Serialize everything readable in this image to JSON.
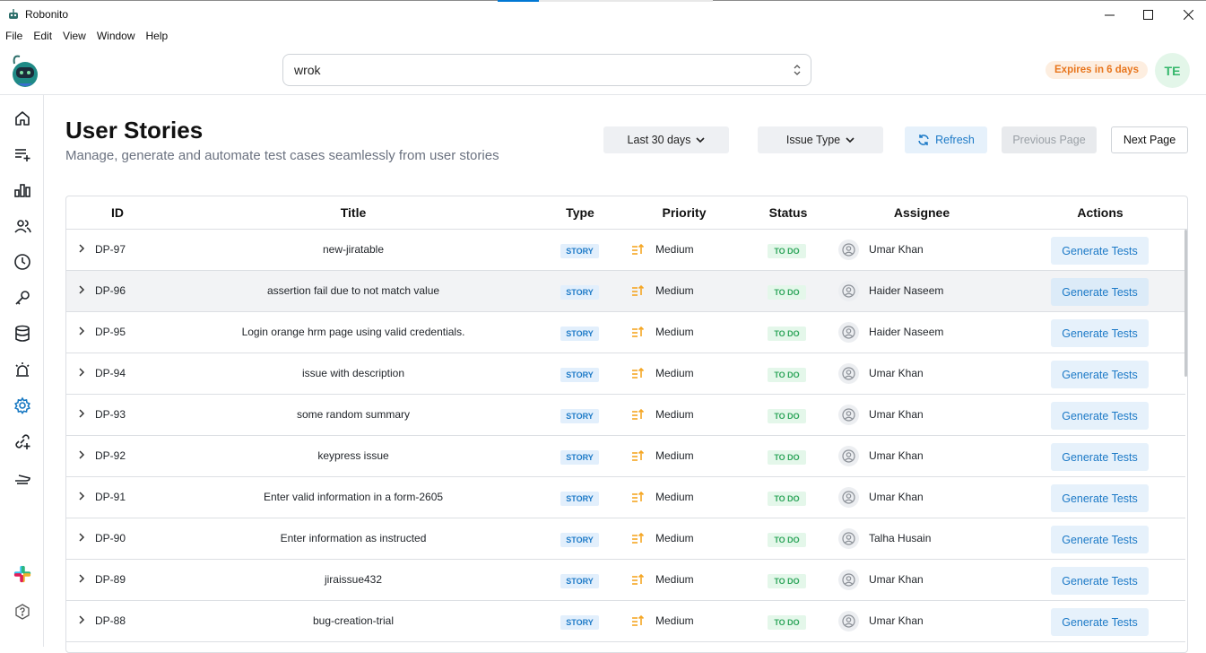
{
  "window": {
    "title": "Robonito",
    "controls": [
      "minimize",
      "maximize",
      "close"
    ]
  },
  "menu": [
    "File",
    "Edit",
    "View",
    "Window",
    "Help"
  ],
  "header": {
    "search_value": "wrok",
    "expires_badge": "Expires in 6 days",
    "avatar_initials": "TE"
  },
  "sidebar": {
    "items": [
      "home-icon",
      "add-list-icon",
      "bar-chart-icon",
      "users-icon",
      "clock-icon",
      "key-icon",
      "database-icon",
      "alarm-icon",
      "settings-icon",
      "link-add-icon",
      "drone-icon",
      "slack-icon",
      "help-icon"
    ],
    "active": "settings-icon"
  },
  "page": {
    "title": "User Stories",
    "subtitle": "Manage, generate and automate test cases seamlessly from user stories"
  },
  "toolbar": {
    "date_filter": "Last 30 days",
    "type_filter": "Issue Type",
    "refresh": "Refresh",
    "previous": "Previous Page",
    "next": "Next Page"
  },
  "table": {
    "columns": [
      "ID",
      "Title",
      "Type",
      "Priority",
      "Status",
      "Assignee",
      "Actions"
    ],
    "rows": [
      {
        "id": "DP-97",
        "title": "new-jiratable",
        "type": "STORY",
        "priority": "Medium",
        "status": "TO DO",
        "assignee": "Umar Khan",
        "action": "Generate Tests"
      },
      {
        "id": "DP-96",
        "title": "assertion fail due to not match value",
        "type": "STORY",
        "priority": "Medium",
        "status": "TO DO",
        "assignee": "Haider Naseem",
        "action": "Generate Tests"
      },
      {
        "id": "DP-95",
        "title": "Login orange hrm page using valid credentials.",
        "type": "STORY",
        "priority": "Medium",
        "status": "TO DO",
        "assignee": "Haider Naseem",
        "action": "Generate Tests"
      },
      {
        "id": "DP-94",
        "title": "issue with description",
        "type": "STORY",
        "priority": "Medium",
        "status": "TO DO",
        "assignee": "Umar Khan",
        "action": "Generate Tests"
      },
      {
        "id": "DP-93",
        "title": "some random summary",
        "type": "STORY",
        "priority": "Medium",
        "status": "TO DO",
        "assignee": "Umar Khan",
        "action": "Generate Tests"
      },
      {
        "id": "DP-92",
        "title": "keypress issue",
        "type": "STORY",
        "priority": "Medium",
        "status": "TO DO",
        "assignee": "Umar Khan",
        "action": "Generate Tests"
      },
      {
        "id": "DP-91",
        "title": "Enter valid information in a form-2605",
        "type": "STORY",
        "priority": "Medium",
        "status": "TO DO",
        "assignee": "Umar Khan",
        "action": "Generate Tests"
      },
      {
        "id": "DP-90",
        "title": "Enter information as instructed",
        "type": "STORY",
        "priority": "Medium",
        "status": "TO DO",
        "assignee": "Talha Husain",
        "action": "Generate Tests"
      },
      {
        "id": "DP-89",
        "title": "jiraissue432",
        "type": "STORY",
        "priority": "Medium",
        "status": "TO DO",
        "assignee": "Umar Khan",
        "action": "Generate Tests"
      },
      {
        "id": "DP-88",
        "title": "bug-creation-trial",
        "type": "STORY",
        "priority": "Medium",
        "status": "TO DO",
        "assignee": "Umar Khan",
        "action": "Generate Tests"
      }
    ]
  },
  "colors": {
    "accent": "#1d7ac7",
    "status_green": "#2da55a",
    "priority_orange": "#f5a623",
    "expires_orange": "#e8761d"
  }
}
